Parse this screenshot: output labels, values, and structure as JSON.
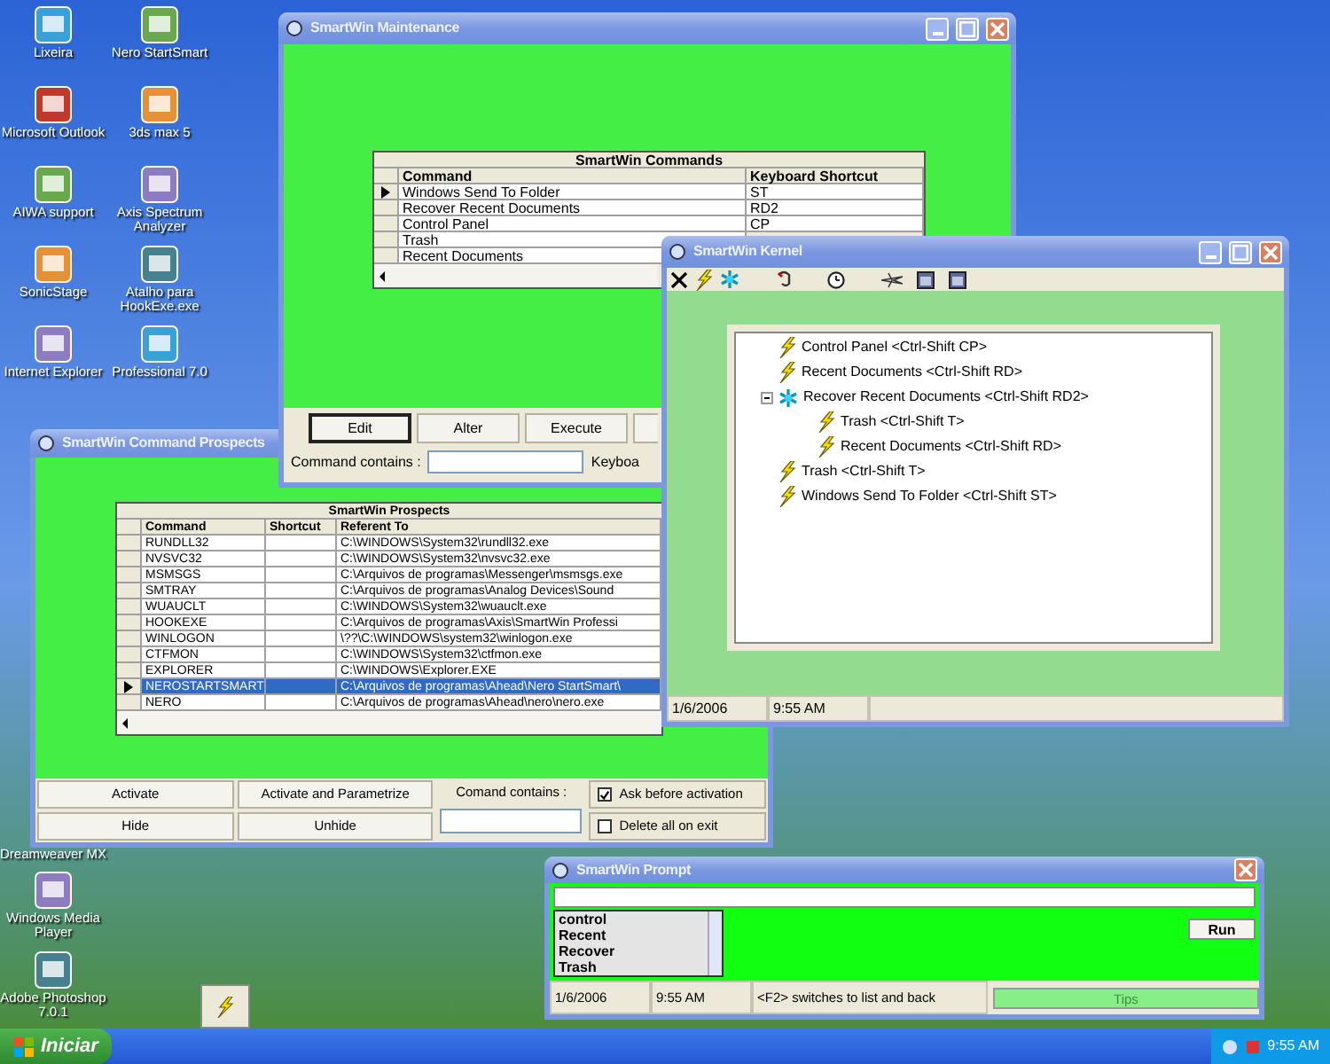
{
  "desktop": {
    "icons_column_1": [
      {
        "label": "Lixeira"
      },
      {
        "label": "Microsoft Outlook"
      },
      {
        "label": "AIWA support"
      },
      {
        "label": "SonicStage"
      },
      {
        "label": "Internet Explorer"
      }
    ],
    "icons_column_2": [
      {
        "label": "Nero StartSmart"
      },
      {
        "label": "3ds max 5"
      },
      {
        "label": "Axis Spectrum Analyzer"
      },
      {
        "label": "Atalho para HookExe.exe"
      },
      {
        "label": "Professional 7.0"
      }
    ],
    "bottom_icons": [
      {
        "kind": "label_only",
        "label": "Dreamweaver MX"
      },
      {
        "kind": "icon",
        "label": "Windows Media Player"
      },
      {
        "kind": "icon",
        "label": "Adobe Photoshop 7.0.1"
      }
    ]
  },
  "prospects": {
    "title": "SmartWin Command Prospects",
    "grid": {
      "title": "SmartWin Prospects",
      "columns": [
        "Command",
        "Shortcut",
        "Referent To"
      ],
      "rows": [
        {
          "command": "RUNDLL32",
          "referent": "C:\\WINDOWS\\System32\\rundll32.exe",
          "selected": false
        },
        {
          "command": "NVSVC32",
          "referent": "C:\\WINDOWS\\System32\\nvsvc32.exe",
          "selected": false
        },
        {
          "command": "MSMSGS",
          "referent": "C:\\Arquivos de programas\\Messenger\\msmsgs.exe",
          "selected": false
        },
        {
          "command": "SMTRAY",
          "referent": "C:\\Arquivos de programas\\Analog Devices\\Sound",
          "selected": false
        },
        {
          "command": "WUAUCLT",
          "referent": "C:\\WINDOWS\\System32\\wuauclt.exe",
          "selected": false
        },
        {
          "command": "HOOKEXE",
          "referent": "C:\\Arquivos de programas\\Axis\\SmartWin Professi",
          "selected": false
        },
        {
          "command": "WINLOGON",
          "referent": "\\??\\C:\\WINDOWS\\system32\\winlogon.exe",
          "selected": false
        },
        {
          "command": "CTFMON",
          "referent": "C:\\WINDOWS\\System32\\ctfmon.exe",
          "selected": false
        },
        {
          "command": "EXPLORER",
          "referent": "C:\\WINDOWS\\Explorer.EXE",
          "selected": false
        },
        {
          "command": "NEROSTARTSMART",
          "referent": "C:\\Arquivos de programas\\Ahead\\Nero StartSmart\\",
          "selected": true
        },
        {
          "command": "NERO",
          "referent": "C:\\Arquivos de programas\\Ahead\\nero\\nero.exe",
          "selected": false
        }
      ]
    },
    "buttons": [
      "Activate",
      "Activate and Parametrize",
      "Hide",
      "Unhide"
    ],
    "filter_label": "Comand contains :",
    "checkboxes": [
      {
        "label": "Ask before activation",
        "checked": true
      },
      {
        "label": "Delete all on exit",
        "checked": false
      }
    ]
  },
  "maintenance": {
    "title": "SmartWin Maintenance",
    "title_buttons": [
      {
        "kind": "minimize"
      },
      {
        "kind": "maximize"
      },
      {
        "kind": "close"
      }
    ],
    "grid": {
      "title": "SmartWin Commands",
      "columns": [
        "Command",
        "Keyboard Shortcut"
      ],
      "rows": [
        {
          "command": "Windows Send To Folder",
          "shortcut": "ST",
          "selected": true
        },
        {
          "command": "Recover Recent Documents",
          "shortcut": "RD2",
          "selected": false
        },
        {
          "command": "Control Panel",
          "shortcut": "CP",
          "selected": false
        },
        {
          "command": "Trash",
          "selected": false
        },
        {
          "command": "Recent Documents",
          "selected": false
        }
      ]
    },
    "buttons": [
      {
        "label": "Edit",
        "default": true
      },
      {
        "label": "Alter",
        "default": false
      },
      {
        "label": "Execute",
        "default": false
      }
    ],
    "filter_label": "Command contains :",
    "shortcut_filter_label": "Keyboa"
  },
  "kernel": {
    "title": "SmartWin Kernel",
    "title_buttons": [
      {
        "kind": "minimize"
      },
      {
        "kind": "maximize"
      },
      {
        "kind": "close"
      }
    ],
    "toolbar": [
      {
        "kind": "delete"
      },
      {
        "kind": "command"
      },
      {
        "kind": "group"
      },
      {
        "kind": "hook"
      },
      {
        "kind": "timer"
      },
      {
        "kind": "plane"
      },
      {
        "kind": "window"
      },
      {
        "kind": "window"
      }
    ],
    "tree": [
      {
        "kind": "command",
        "label": "Control Panel <Ctrl-Shift CP>"
      },
      {
        "kind": "command",
        "label": "Recent Documents <Ctrl-Shift RD>"
      },
      {
        "kind": "group",
        "label": "Recover Recent Documents <Ctrl-Shift RD2>",
        "expanded": true,
        "children": [
          {
            "kind": "command",
            "label": "Trash <Ctrl-Shift T>"
          },
          {
            "kind": "command",
            "label": "Recent Documents <Ctrl-Shift RD>"
          }
        ]
      },
      {
        "kind": "command",
        "label": "Trash <Ctrl-Shift T>"
      },
      {
        "kind": "command",
        "label": "Windows Send To Folder <Ctrl-Shift ST>"
      }
    ],
    "status": [
      "1/6/2006",
      "9:55 AM"
    ]
  },
  "prompt": {
    "title": "SmartWin Prompt",
    "title_buttons": [
      {
        "kind": "close"
      }
    ],
    "list": [
      "control",
      "Recent",
      "Recover",
      "Trash"
    ],
    "run_button": "Run",
    "status": [
      "1/6/2006",
      "9:55 AM",
      "<F2> switches to list and back"
    ],
    "tips": {
      "label": "Tips",
      "disabled": true
    }
  },
  "taskbar": {
    "start": "Iniciar",
    "clock": "9:55 AM"
  }
}
